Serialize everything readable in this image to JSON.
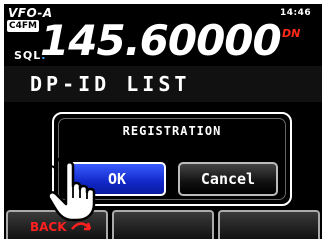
{
  "status": {
    "vfo": "VFO-A",
    "mode": "C4FM",
    "clock": "14:46",
    "sql": "SQL",
    "frequency": "145.600",
    "frequency_sub": "00",
    "dn": "DN"
  },
  "page": {
    "title": "DP-ID LIST"
  },
  "dialog": {
    "title": "REGISTRATION",
    "ok_label": "OK",
    "cancel_label": "Cancel"
  },
  "softkeys": {
    "back_label": "BACK"
  },
  "colors": {
    "ok_button": "#1a35e0",
    "softkey_text": "#ff2020",
    "dn_indicator": "#ff2a1a"
  },
  "icons": [
    "hand-pointer-icon",
    "back-arrow-icon"
  ]
}
